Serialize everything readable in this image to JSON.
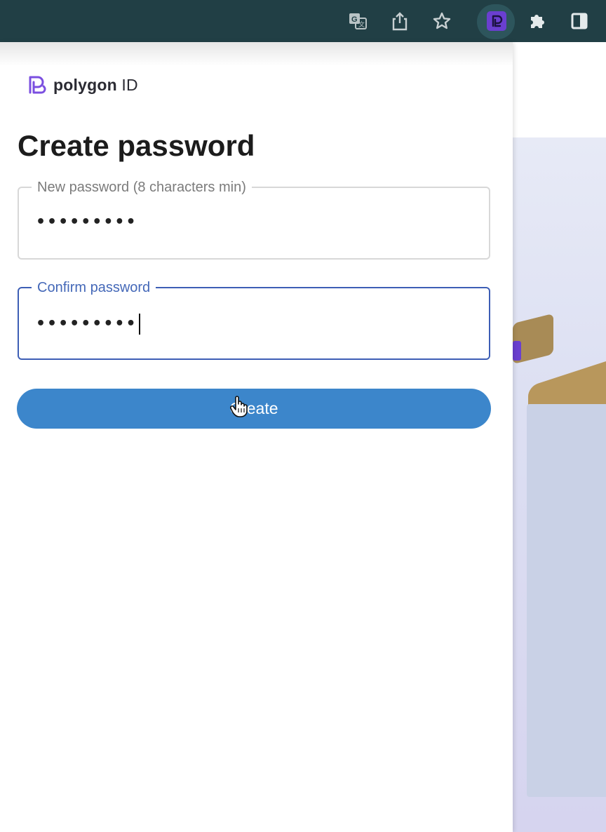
{
  "browser": {
    "icons": [
      "translate-icon",
      "share-icon",
      "bookmark-star-icon",
      "polygon-extension-icon",
      "extensions-puzzle-icon",
      "side-panel-icon"
    ],
    "toolbar_color": "#213f45"
  },
  "popup": {
    "logo": {
      "word": "polygon",
      "suffix": " ID"
    },
    "title": "Create password",
    "new_password": {
      "label": "New password (8 characters min)",
      "value": "•••••••••"
    },
    "confirm_password": {
      "label": "Confirm password",
      "value": "•••••••••"
    },
    "create_button": "Create",
    "accent": "#3c86cb",
    "focus_color": "#4468b8"
  }
}
